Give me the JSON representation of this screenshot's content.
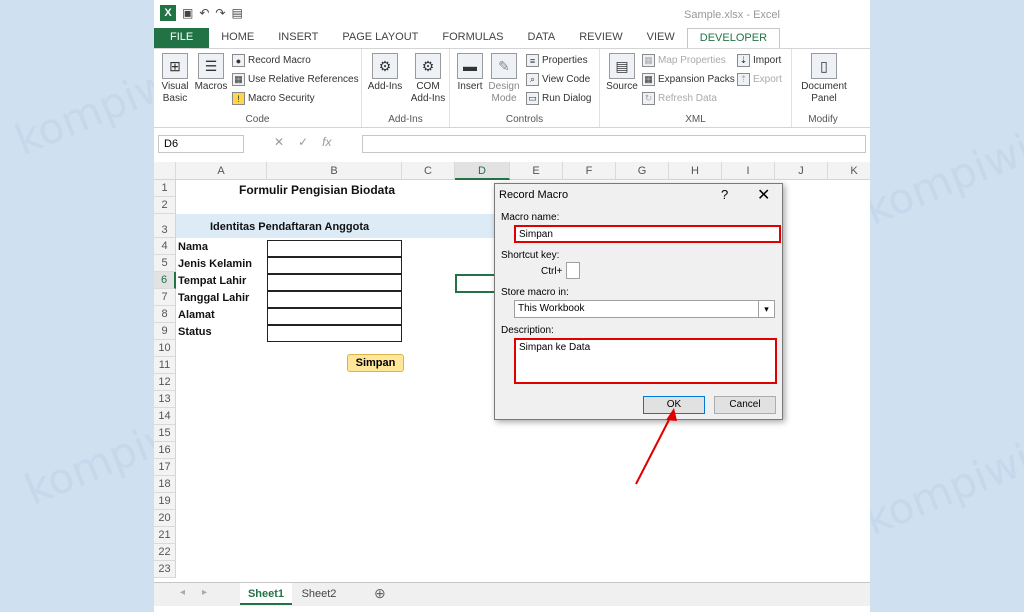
{
  "window": {
    "title": "Sample.xlsx - Excel"
  },
  "qat": {
    "logo": "X",
    "undo": "↶",
    "redo": "↷"
  },
  "tabs": [
    "FILE",
    "HOME",
    "INSERT",
    "PAGE LAYOUT",
    "FORMULAS",
    "DATA",
    "REVIEW",
    "VIEW",
    "DEVELOPER"
  ],
  "ribbon": {
    "code": {
      "label": "Code",
      "visual_basic": "Visual Basic",
      "macros": "Macros",
      "record_macro": "Record Macro",
      "relative_refs": "Use Relative References",
      "macro_security": "Macro Security"
    },
    "addins": {
      "label": "Add-Ins",
      "addins": "Add-Ins",
      "com_addins": "COM Add-Ins"
    },
    "controls": {
      "label": "Controls",
      "insert": "Insert",
      "design_mode": "Design Mode",
      "properties": "Properties",
      "view_code": "View Code",
      "run_dialog": "Run Dialog"
    },
    "xml": {
      "label": "XML",
      "source": "Source",
      "map_properties": "Map Properties",
      "expansion_packs": "Expansion Packs",
      "refresh_data": "Refresh Data",
      "import": "Import",
      "export": "Export"
    },
    "modify": {
      "label": "Modify",
      "document_panel": "Document Panel"
    }
  },
  "formula_bar": {
    "name_box": "D6",
    "cancel": "✕",
    "enter": "✓",
    "fx": "fx",
    "value": ""
  },
  "columns": [
    "A",
    "B",
    "C",
    "D",
    "E",
    "F",
    "G",
    "H",
    "I",
    "J",
    "K"
  ],
  "rows": [
    "1",
    "2",
    "3",
    "4",
    "5",
    "6",
    "7",
    "8",
    "9",
    "10",
    "11",
    "12",
    "13",
    "14",
    "15",
    "16",
    "17",
    "18",
    "19",
    "20",
    "21",
    "22",
    "23"
  ],
  "sheet": {
    "title": "Formulir Pengisian Biodata",
    "subtitle": "Identitas Pendaftaran Anggota",
    "fields": [
      "Nama",
      "Jenis Kelamin",
      "Tempat Lahir",
      "Tanggal Lahir",
      "Alamat",
      "Status"
    ],
    "button": "Simpan"
  },
  "sheet_tabs": [
    "Sheet1",
    "Sheet2"
  ],
  "dialog": {
    "title": "Record Macro",
    "help": "?",
    "close": "✕",
    "macro_name_label": "Macro name:",
    "macro_name": "Simpan",
    "shortcut_label": "Shortcut key:",
    "ctrl": "Ctrl+",
    "store_label": "Store macro in:",
    "store_value": "This Workbook",
    "description_label": "Description:",
    "description": "Simpan ke Data",
    "ok": "OK",
    "cancel": "Cancel"
  },
  "watermark": "kompiwin",
  "colors": {
    "excel_green": "#217346",
    "highlight_red": "#e00000",
    "banner_blue": "#ddebf7",
    "button_yellow": "#ffe699"
  }
}
